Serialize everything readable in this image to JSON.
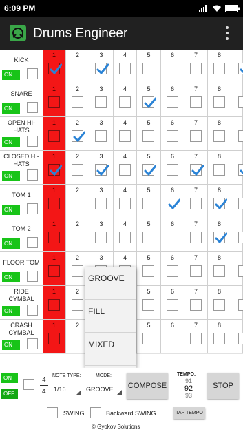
{
  "status": {
    "time": "6:09 PM",
    "battery": "battery-icon",
    "wifi": "wifi-icon",
    "signal": "signal-icon"
  },
  "app": {
    "title": "Drums Engineer",
    "logo": "app-logo-icon",
    "menu": "overflow-menu-icon"
  },
  "steps": [
    "1",
    "2",
    "3",
    "4",
    "5",
    "6",
    "7",
    "8"
  ],
  "colors": {
    "active_column": "#f31616",
    "on_button": "#18c418",
    "check": "#2a83d6"
  },
  "tracks": [
    {
      "name": [
        "KICK"
      ],
      "on": "ON",
      "checked": [
        true,
        false,
        true,
        false,
        false,
        false,
        false,
        false
      ]
    },
    {
      "name": [
        "SNARE"
      ],
      "on": "ON",
      "checked": [
        false,
        false,
        false,
        false,
        true,
        false,
        false,
        false
      ]
    },
    {
      "name": [
        "OPEN HI-",
        "HATS"
      ],
      "on": "ON",
      "checked": [
        false,
        true,
        false,
        false,
        false,
        false,
        false,
        false
      ]
    },
    {
      "name": [
        "CLOSED HI-",
        "HATS"
      ],
      "on": "ON",
      "checked": [
        true,
        false,
        true,
        false,
        true,
        false,
        true,
        false
      ]
    },
    {
      "name": [
        "TOM 1"
      ],
      "on": "ON",
      "checked": [
        false,
        false,
        false,
        false,
        false,
        true,
        false,
        true
      ]
    },
    {
      "name": [
        "TOM 2"
      ],
      "on": "ON",
      "checked": [
        false,
        false,
        false,
        false,
        false,
        false,
        false,
        true
      ]
    },
    {
      "name": [
        "FLOOR TOM"
      ],
      "on": "ON",
      "checked": [
        false,
        false,
        false,
        false,
        false,
        false,
        false,
        false
      ]
    },
    {
      "name": [
        "RIDE",
        "CYMBAL"
      ],
      "on": "ON",
      "checked": [
        false,
        false,
        false,
        false,
        false,
        false,
        false,
        false
      ]
    },
    {
      "name": [
        "CRASH",
        "CYMBAL"
      ],
      "on": "ON",
      "checked": [
        false,
        false,
        false,
        false,
        false,
        false,
        false,
        false
      ]
    }
  ],
  "popup": {
    "options": [
      "GROOVE",
      "FILL",
      "MIXED"
    ]
  },
  "controls": {
    "on": "ON",
    "off": "OFF",
    "time_sig_top": "4",
    "time_sig_bottom": "4",
    "note_type_label": "NOTE TYPE:",
    "note_type_value": "1/16",
    "mode_label": "MODE:",
    "mode_value": "GROOVE",
    "compose": "COMPOSE",
    "tempo_label": "TEMPO:",
    "tempo_prev": "91",
    "tempo_value": "92",
    "tempo_next": "93",
    "stop": "STOP",
    "swing": "SWING",
    "backward_swing": "Backward SWING",
    "tap_tempo": "TAP TEMPO",
    "copyright": "© Gyokov Solutions"
  }
}
